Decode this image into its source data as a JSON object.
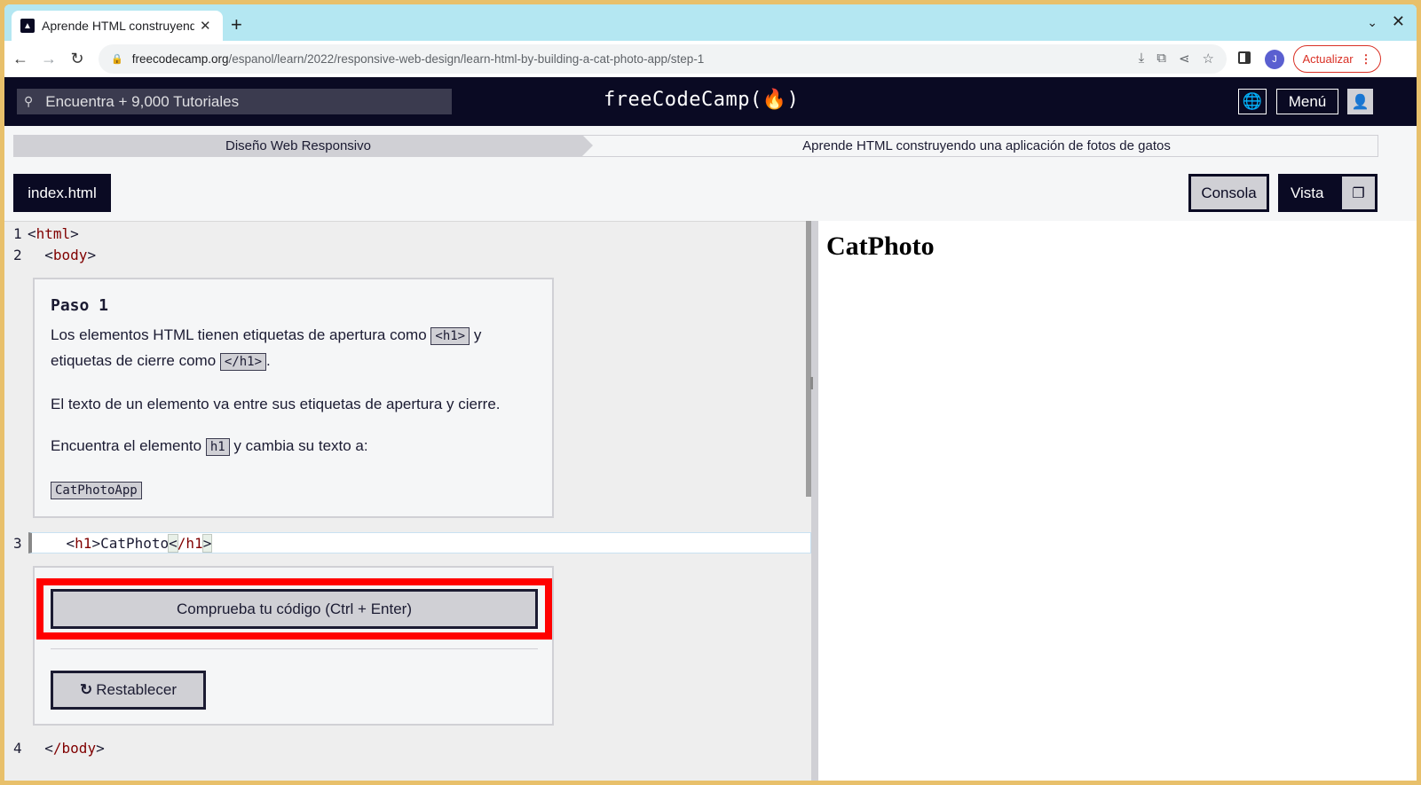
{
  "browser": {
    "tab_title": "Aprende HTML construyendo",
    "new_tab_label": "+",
    "close_label": "✕",
    "url_host": "freecodecamp.org",
    "url_path": "/espanol/learn/2022/responsive-web-design/learn-html-by-building-a-cat-photo-app/step-1",
    "profile_initial": "J",
    "update_label": "Actualizar"
  },
  "navbar": {
    "search_placeholder": "Encuentra + 9,000 Tutoriales",
    "logo": "freeCodeCamp(🔥)",
    "menu_label": "Menú"
  },
  "breadcrumb": {
    "superblock": "Diseño Web Responsivo",
    "block": "Aprende HTML construyendo una aplicación de fotos de gatos"
  },
  "editor_header": {
    "file_tab": "index.html",
    "console_label": "Consola",
    "preview_label": "Vista"
  },
  "code": {
    "line_numbers": [
      "1",
      "2",
      "3",
      "4"
    ],
    "line1_tag": "html",
    "line2_tag": "body",
    "line3_open_tag": "h1",
    "line3_text": "CatPhoto",
    "line3_close_tag": "/h1",
    "line4_tag": "/body"
  },
  "description": {
    "title": "Paso 1",
    "p1_a": "Los elementos HTML tienen etiquetas de apertura como ",
    "p1_code1": "<h1>",
    "p1_b": " y etiquetas de cierre como ",
    "p1_code2": "</h1>",
    "p1_c": ".",
    "p2": "El texto de un elemento va entre sus etiquetas de apertura y cierre.",
    "p3_a": "Encuentra el elemento ",
    "p3_code": "h1",
    "p3_b": " y cambia su texto a:",
    "answer_code": "CatPhotoApp"
  },
  "actions": {
    "check_label": "Comprueba tu código (Ctrl + Enter)",
    "reset_label": "Restablecer"
  },
  "preview": {
    "heading": "CatPhoto"
  },
  "colors": {
    "accent_dark": "#0a0a23",
    "highlight_red": "#ff0000",
    "tag_color": "#800000"
  }
}
